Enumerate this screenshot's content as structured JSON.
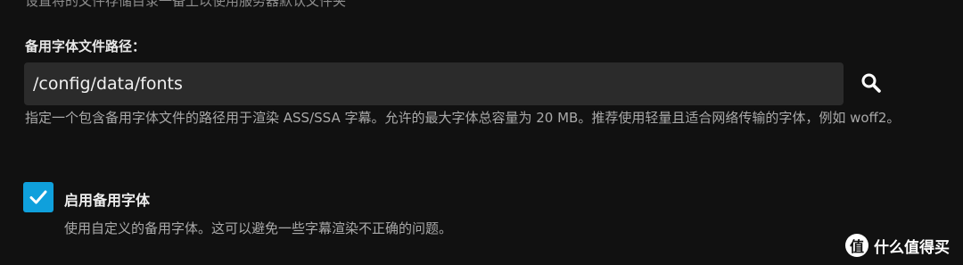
{
  "top_cut_text": "设置将的文件存储目录一备上以使用服务器默认文件夹",
  "fallback_font": {
    "label": "备用字体文件路径：",
    "path_value": "/config/data/fonts",
    "help_text": "指定一个包含备用字体文件的路径用于渲染 ASS/SSA 字幕。允许的最大字体总容量为 20 MB。推荐使用轻量且适合网络传输的字体，例如 woff2。",
    "search_icon": "search-icon"
  },
  "enable_fallback": {
    "label": "启用备用字体",
    "checked": true,
    "description": "使用自定义的备用字体。这可以避免一些字幕渲染不正确的问题。",
    "check_icon": "check-icon"
  },
  "watermark": {
    "logo_glyph": "值",
    "text": "什么值得买"
  },
  "colors": {
    "background": "#111111",
    "input_bg": "#2b2b2b",
    "accent": "#0fa0dc"
  }
}
